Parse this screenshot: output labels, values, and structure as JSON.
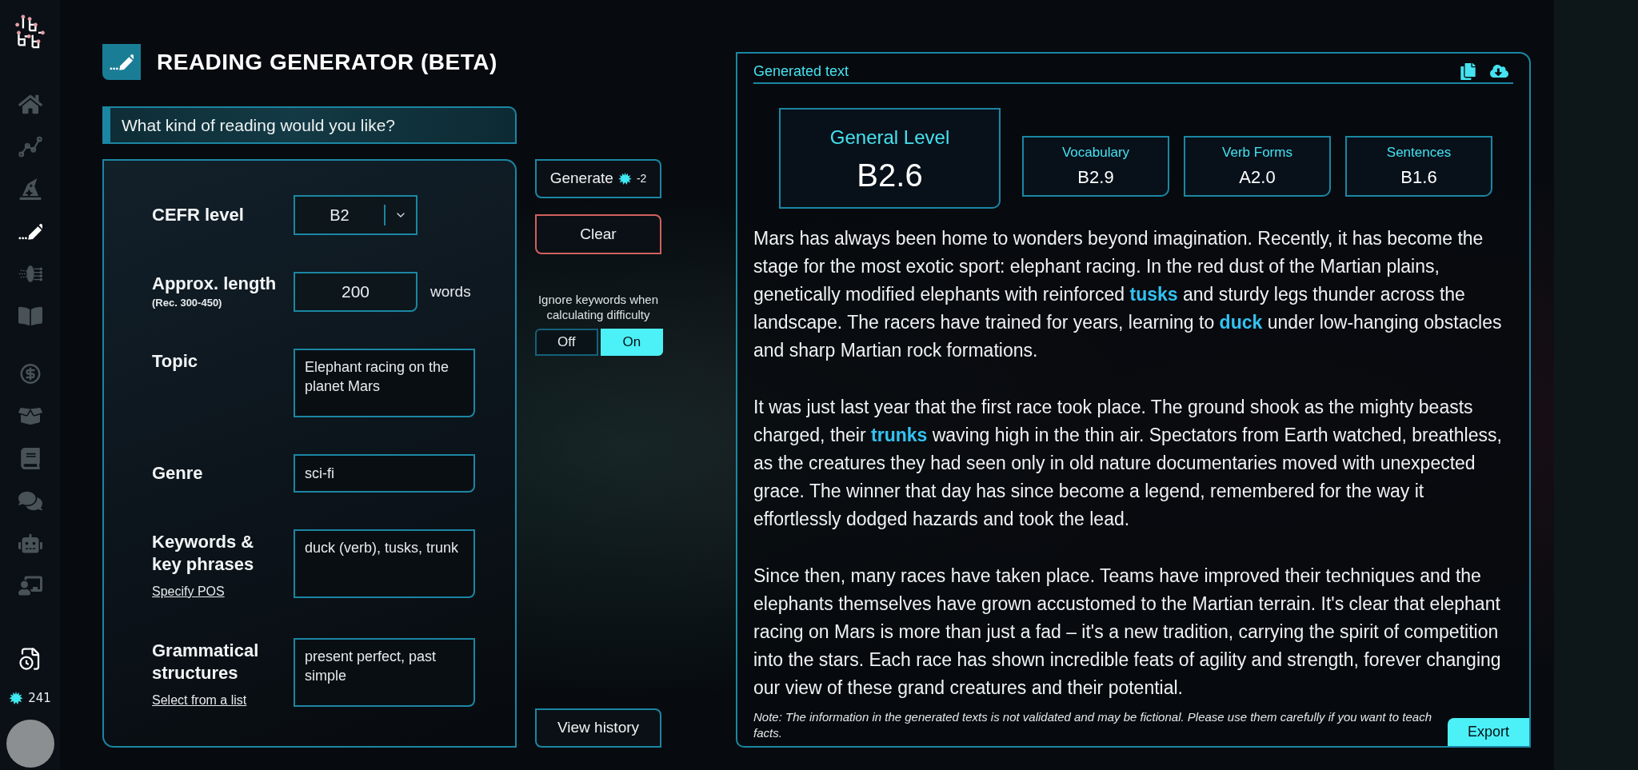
{
  "sidebar": {
    "groups": [
      {
        "items": [
          {
            "selected": false
          },
          {
            "selected": false
          },
          {
            "selected": false
          },
          {
            "selected": true
          },
          {
            "selected": false
          },
          {
            "selected": false
          }
        ]
      },
      {
        "items": [
          {
            "selected": false
          },
          {
            "selected": false
          },
          {
            "selected": false
          },
          {
            "selected": false
          },
          {
            "selected": false
          },
          {
            "selected": false
          }
        ]
      }
    ],
    "credits": "241"
  },
  "header": {
    "title": "READING GENERATOR (BETA)"
  },
  "form": {
    "question": "What kind of reading would you like?",
    "fields": [
      {
        "kind": "select",
        "label": "CEFR level",
        "value": "B2"
      },
      {
        "kind": "number",
        "label": "Approx. length",
        "hint": "(Rec. 300-450)",
        "value": "200",
        "unit": "words"
      },
      {
        "kind": "textarea",
        "label": "Topic",
        "value": "Elephant racing on the planet Mars"
      },
      {
        "kind": "text",
        "label": "Genre",
        "value": "sci-fi"
      },
      {
        "kind": "textarea",
        "label": "Keywords & key phrases",
        "link": "Specify POS",
        "value": "duck (verb), tusks, trunk"
      },
      {
        "kind": "textarea",
        "label": "Grammatical structures",
        "link": "Select from a list",
        "value": "present perfect, past simple"
      }
    ]
  },
  "actions": {
    "generate": {
      "label": "Generate",
      "cost": "-2"
    },
    "clear": "Clear",
    "toggle": {
      "label": "Ignore keywords when calculating difficulty",
      "options": [
        {
          "label": "Off",
          "selected": false
        },
        {
          "label": "On",
          "selected": true
        }
      ]
    },
    "history": "View history"
  },
  "output": {
    "title": "Generated text",
    "general": {
      "label": "General Level",
      "value": "B2.6"
    },
    "scores": [
      {
        "label": "Vocabulary",
        "value": "B2.9"
      },
      {
        "label": "Verb Forms",
        "value": "A2.0"
      },
      {
        "label": "Sentences",
        "value": "B1.6"
      }
    ],
    "paragraphs": [
      "Mars has always been home to wonders beyond imagination. Recently, it has become the stage for the most exotic sport: elephant racing. In the red dust of the Martian plains, genetically modified elephants with reinforced **tusks** and sturdy legs thunder across the landscape. The racers have trained for years, learning to **duck** under low-hanging obstacles and sharp Martian rock formations.",
      "It was just last year that the first race took place. The ground shook as the mighty beasts charged, their **trunks** waving high in the thin air. Spectators from Earth watched, breathless, as the creatures they had seen only in old nature documentaries moved with unexpected grace. The winner that day has since become a legend, remembered for the way it effortlessly dodged hazards and took the lead.",
      "Since then, many races have taken place. Teams have improved their techniques and the elephants themselves have grown accustomed to the Martian terrain. It's clear that elephant racing on Mars is more than just a fad – it's a new tradition, carrying the spirit of competition into the stars. Each race has shown incredible feats of agility and strength, forever changing our view of these grand creatures and their potential."
    ],
    "note": "Note: The information in the generated texts is not validated and may be fictional. Please use them carefully if you want to teach facts.",
    "export": "Export"
  }
}
